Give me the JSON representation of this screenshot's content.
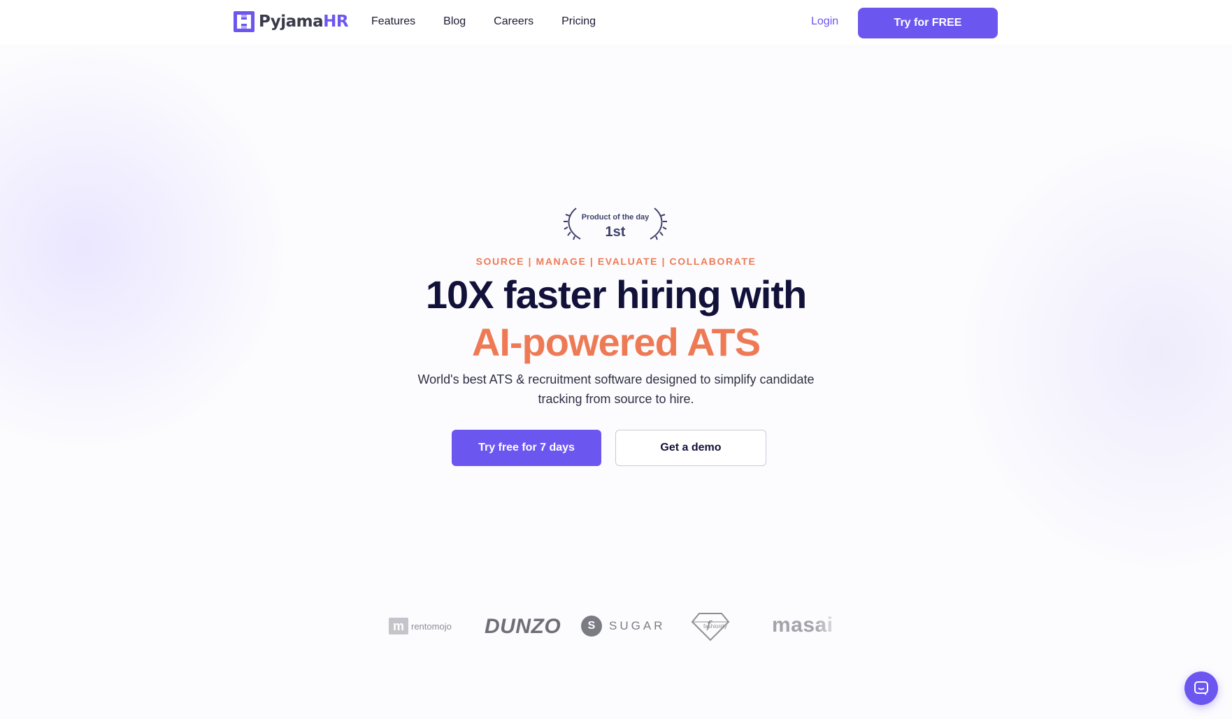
{
  "brand": {
    "name_main": "Pyjama",
    "name_accent": "HR",
    "accent_color": "#6c56f0",
    "orange_color": "#ee7a55",
    "logo_icon": "pyjamahr-logo-icon"
  },
  "nav": {
    "items": [
      "Features",
      "Blog",
      "Careers",
      "Pricing"
    ],
    "login": "Login",
    "cta": "Try for FREE"
  },
  "hero": {
    "award_title": "Product of the day",
    "award_rank": "1st",
    "tagline": "SOURCE  | MANAGE  | EVALUATE  | COLLABORATE",
    "headline": "10X faster hiring with",
    "headline_accent": "AI-powered ATS",
    "subtext": "World's best ATS & recruitment software designed to simplify candidate tracking from source to hire.",
    "primary_button": "Try free for 7 days",
    "secondary_button": "Get a demo"
  },
  "clients": {
    "rentomojo": "rentomojo",
    "rentomojo_mark": "m",
    "dunzo": "DUNZO",
    "sugar": "SUGAR",
    "sugar_mark": "S",
    "fashionity": "fashionity",
    "fashionity_mark": "f",
    "masai": "masai"
  },
  "chat": {
    "icon": "chat-bubble-icon"
  }
}
